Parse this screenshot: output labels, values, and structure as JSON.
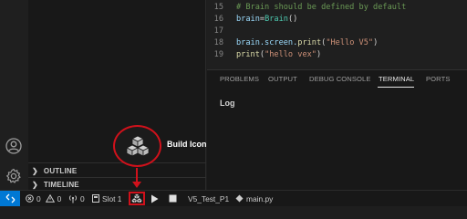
{
  "editor": {
    "lines": [
      {
        "num": "15",
        "comment": "# Brain should be defined by default"
      },
      {
        "num": "16",
        "var": "brain",
        "op": "=",
        "cls": "Brain",
        "paren": "()"
      },
      {
        "num": "17"
      },
      {
        "num": "18",
        "obj": "brain.screen.",
        "fn": "print",
        "open": "(",
        "str": "\"Hello V5\"",
        "close": ")"
      },
      {
        "num": "19",
        "fn": "print",
        "open": "(",
        "str": "\"hello vex\"",
        "close": ")"
      }
    ]
  },
  "panel": {
    "tabs": [
      "PROBLEMS",
      "OUTPUT",
      "DEBUG CONSOLE",
      "TERMINAL",
      "PORTS"
    ],
    "active_tab": "TERMINAL",
    "content_label": "Log"
  },
  "sidebar": {
    "sections": [
      "OUTLINE",
      "TIMELINE"
    ]
  },
  "annotation": {
    "label": "Build Icon"
  },
  "status_bar": {
    "errors": "0",
    "warnings": "0",
    "ports": "0",
    "slot": "Slot 1",
    "project": "V5_Test_P1",
    "file": "main.py"
  },
  "colors": {
    "accent": "#0078d4",
    "annotation_red": "#d0111b"
  }
}
